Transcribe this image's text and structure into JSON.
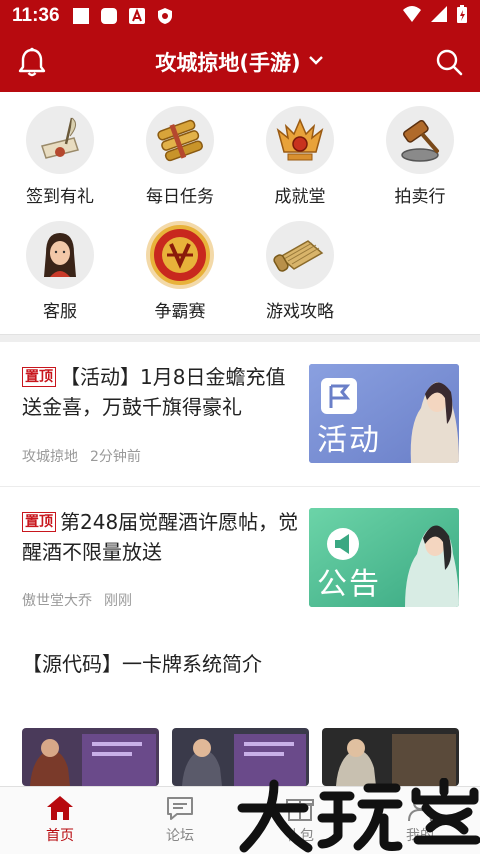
{
  "status_bar": {
    "time": "11:36"
  },
  "header": {
    "title": "攻城掠地(手游)"
  },
  "grid": [
    {
      "label": "签到有礼",
      "icon": "quill-scroll-icon"
    },
    {
      "label": "每日任务",
      "icon": "scrolls-icon"
    },
    {
      "label": "成就堂",
      "icon": "trophy-crest-icon"
    },
    {
      "label": "拍卖行",
      "icon": "auction-hammer-icon"
    },
    {
      "label": "客服",
      "icon": "service-avatar-icon"
    },
    {
      "label": "争霸赛",
      "icon": "battle-emblem-icon"
    },
    {
      "label": "游戏攻略",
      "icon": "guide-scroll-icon"
    }
  ],
  "articles": [
    {
      "badge": "置顶",
      "title": "【活动】1月8日金蟾充值送金喜，万鼓千旗得豪礼",
      "author": "攻城掠地",
      "time": "2分钟前",
      "thumb_label": "活动",
      "thumb_color": "#7f97d8"
    },
    {
      "badge": "置顶",
      "title": "第248届觉醒酒许愿帖，觉醒酒不限量放送",
      "author": "傲世堂大乔",
      "time": "刚刚",
      "thumb_label": "公告",
      "thumb_color": "#58c29a"
    }
  ],
  "post": {
    "title": "【源代码】一卡牌系统简介"
  },
  "bottom_nav": [
    {
      "label": "首页",
      "icon": "home-icon",
      "active": true
    },
    {
      "label": "论坛",
      "icon": "forum-icon",
      "active": false
    },
    {
      "label": "礼包",
      "icon": "gift-icon",
      "active": false
    },
    {
      "label": "我的",
      "icon": "profile-icon",
      "active": false
    }
  ],
  "colors": {
    "brand": "#b70a0f",
    "badge": "#c8161d"
  },
  "watermark": {
    "text": "大玩家"
  }
}
